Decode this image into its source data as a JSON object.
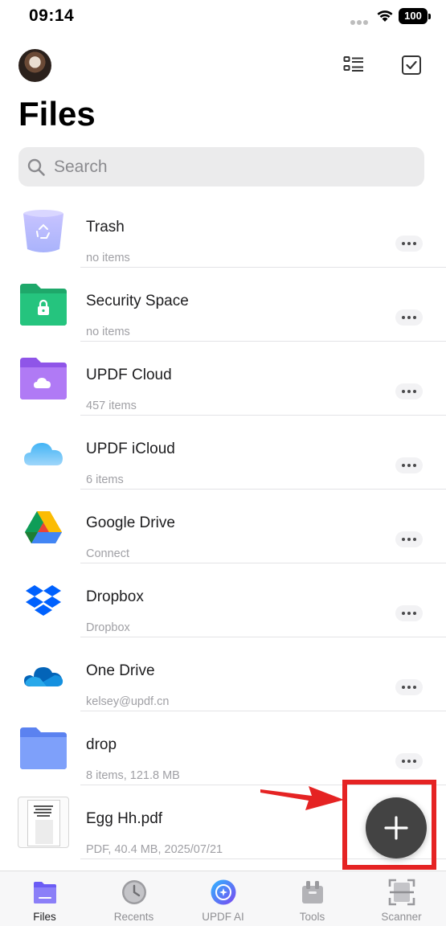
{
  "status_bar": {
    "time": "09:14",
    "battery": "100"
  },
  "header": {
    "title": "Files"
  },
  "search": {
    "placeholder": "Search"
  },
  "files": [
    {
      "title": "Trash",
      "subtitle": "no items",
      "icon": "trash-bin-icon"
    },
    {
      "title": "Security Space",
      "subtitle": "no items",
      "icon": "locked-folder-icon"
    },
    {
      "title": "UPDF Cloud",
      "subtitle": "457 items",
      "icon": "cloud-folder-icon"
    },
    {
      "title": "UPDF iCloud",
      "subtitle": "6 items",
      "icon": "icloud-icon"
    },
    {
      "title": "Google Drive",
      "subtitle": "Connect",
      "icon": "google-drive-icon"
    },
    {
      "title": "Dropbox",
      "subtitle": "Dropbox",
      "icon": "dropbox-icon"
    },
    {
      "title": "One Drive",
      "subtitle": "kelsey@updf.cn",
      "icon": "onedrive-icon"
    },
    {
      "title": "drop",
      "subtitle": "8 items, 121.8 MB",
      "icon": "folder-icon"
    },
    {
      "title": "Egg Hh.pdf",
      "subtitle": "PDF, 40.4 MB, 2025/07/21",
      "icon": "pdf-thumbnail-icon"
    }
  ],
  "tabs": [
    {
      "label": "Files",
      "icon": "files-icon",
      "active": true
    },
    {
      "label": "Recents",
      "icon": "clock-icon",
      "active": false
    },
    {
      "label": "UPDF AI",
      "icon": "ai-icon",
      "active": false
    },
    {
      "label": "Tools",
      "icon": "toolbox-icon",
      "active": false
    },
    {
      "label": "Scanner",
      "icon": "scanner-icon",
      "active": false
    }
  ],
  "colors": {
    "accent_purple": "#6b5cf5",
    "fab": "#434343",
    "annotation_red": "#e52323",
    "security_green": "#22b573",
    "cloud_purple": "#a66ff0",
    "folder_blue": "#6f93f7"
  }
}
